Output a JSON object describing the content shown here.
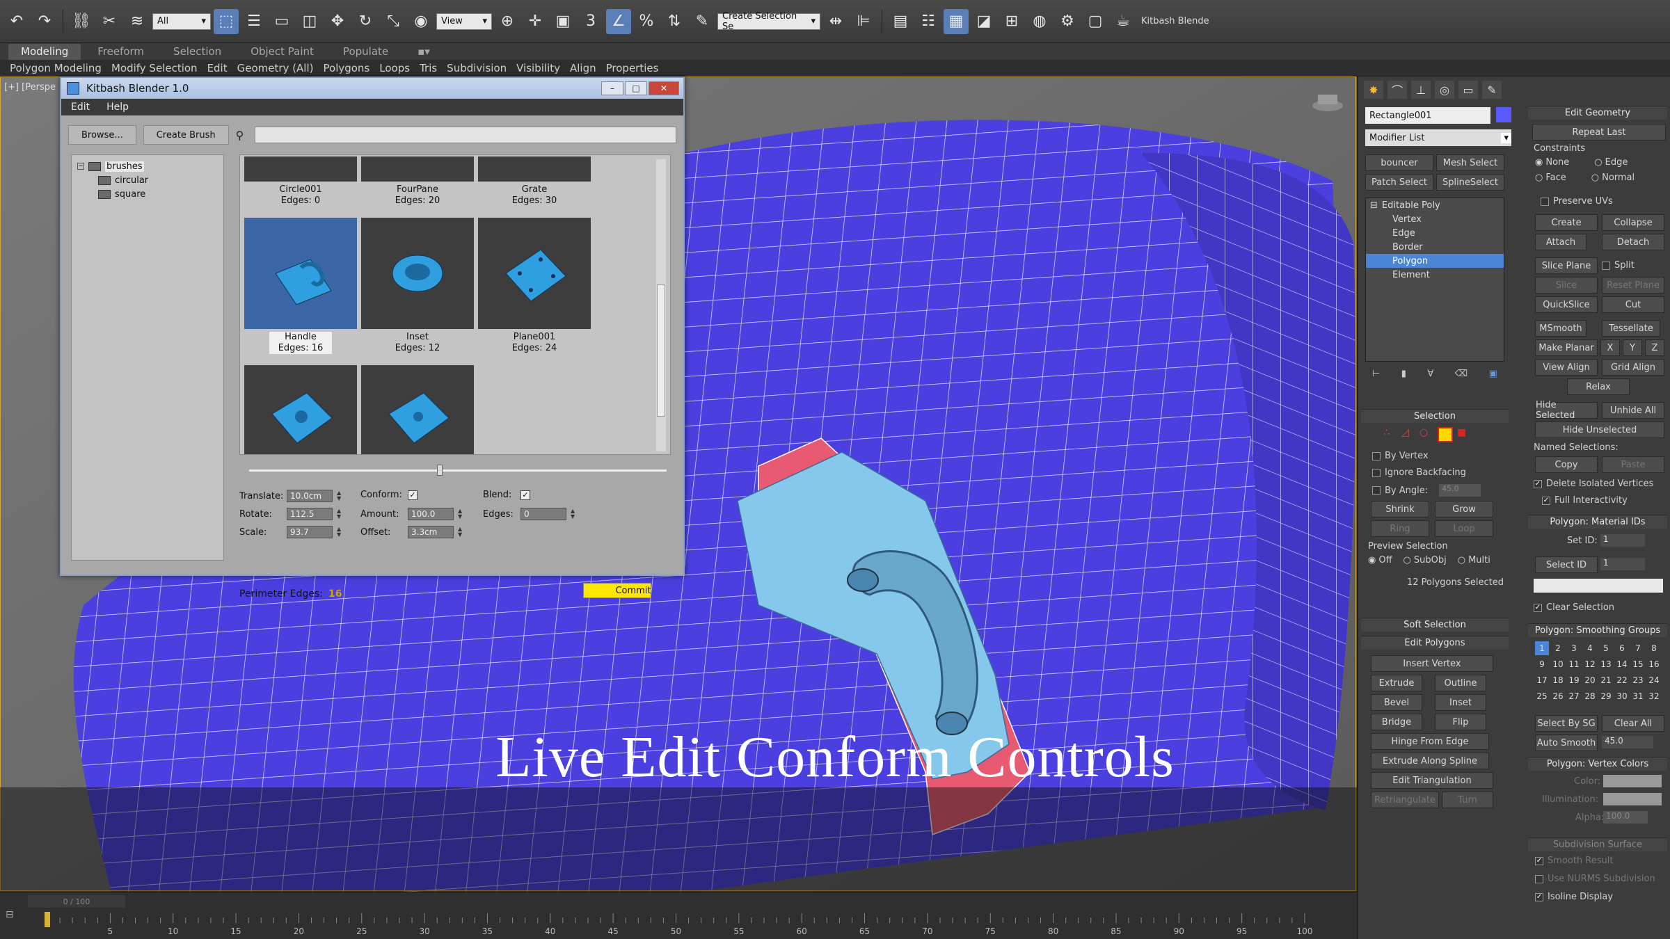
{
  "toolbar": {
    "selection_filter": "All",
    "ref_coord": "View",
    "named_selection": "Create Selection Se",
    "plugin_label": "Kitbash Blende",
    "snap_3": "3",
    "icons": [
      "undo-icon",
      "redo-icon",
      "link-icon",
      "unlink-icon",
      "bind-space-warp-icon",
      "select-object-icon",
      "select-by-name-icon",
      "rect-region-icon",
      "window-crossing-icon",
      "move-icon",
      "rotate-icon",
      "scale-icon",
      "place-icon",
      "pivot-icon",
      "snap-icon",
      "angle-snap-icon",
      "percent-snap-icon",
      "spinner-snap-icon",
      "edit-named-sel-icon",
      "mirror-icon",
      "align-icon",
      "layer-icon",
      "scene-explorer-icon",
      "graph-editor-icon",
      "material-editor-icon",
      "render-setup-icon",
      "render-frame-icon",
      "render-icon"
    ]
  },
  "ribbon": {
    "tabs": [
      "Modeling",
      "Freeform",
      "Selection",
      "Object Paint",
      "Populate"
    ],
    "active_tab": "Modeling",
    "subitems": [
      "Polygon Modeling",
      "Modify Selection",
      "Edit",
      "Geometry (All)",
      "Polygons",
      "Loops",
      "Tris",
      "Subdivision",
      "Visibility",
      "Align",
      "Properties"
    ]
  },
  "viewport": {
    "label": "[+] [Perspe",
    "caption": "Live Edit Conform Controls"
  },
  "kitbash": {
    "title": "Kitbash Blender 1.0",
    "menu": [
      "Edit",
      "Help"
    ],
    "browse": "Browse...",
    "create_brush": "Create Brush",
    "search_placeholder": "",
    "tree": {
      "root": "brushes",
      "children": [
        "circular",
        "square"
      ]
    },
    "brushes": [
      {
        "name": "Circle001",
        "edges": "Edges: 0"
      },
      {
        "name": "FourPane",
        "edges": "Edges: 20"
      },
      {
        "name": "Grate",
        "edges": "Edges: 30"
      },
      {
        "name": "Handle",
        "edges": "Edges: 16"
      },
      {
        "name": "Inset",
        "edges": "Edges: 12"
      },
      {
        "name": "Plane001",
        "edges": "Edges: 24"
      },
      {
        "name": "",
        "edges": ""
      },
      {
        "name": "",
        "edges": ""
      }
    ],
    "params": {
      "translate_label": "Translate:",
      "translate": "10.0cm",
      "rotate_label": "Rotate:",
      "rotate": "112.5",
      "scale_label": "Scale:",
      "scale": "93.7",
      "conform_label": "Conform:",
      "amount_label": "Amount:",
      "amount": "100.0",
      "offset_label": "Offset:",
      "offset": "3.3cm",
      "blend_label": "Blend:",
      "edges_label": "Edges:",
      "edges": "0"
    },
    "perimeter_label": "Perimeter Edges:",
    "perimeter_value": "16",
    "commit": "Commit",
    "colors": {
      "accent_yellow": "#ffe800"
    }
  },
  "command_panel": {
    "object_name": "Rectangle001",
    "modifier_list": "Modifier List",
    "buttons_top": [
      "bouncer",
      "Mesh Select",
      "Patch Select",
      "SplineSelect"
    ],
    "stack": [
      "Editable Poly",
      "Vertex",
      "Edge",
      "Border",
      "Polygon",
      "Element"
    ],
    "stack_selected": "Polygon",
    "selection": {
      "title": "Selection",
      "by_vertex": "By Vertex",
      "ignore_backfacing": "Ignore Backfacing",
      "by_angle": "By Angle:",
      "angle": "45.0",
      "shrink": "Shrink",
      "grow": "Grow",
      "ring": "Ring",
      "loop": "Loop",
      "preview_selection": "Preview Selection",
      "preview_opts": [
        "Off",
        "SubObj",
        "Multi"
      ],
      "status": "12 Polygons Selected"
    },
    "soft_selection": "Soft Selection",
    "edit_polygons": {
      "title": "Edit Polygons",
      "insert_vertex": "Insert Vertex",
      "extrude": "Extrude",
      "outline": "Outline",
      "bevel": "Bevel",
      "inset": "Inset",
      "bridge": "Bridge",
      "flip": "Flip",
      "hinge": "Hinge From Edge",
      "extrude_spline": "Extrude Along Spline",
      "edit_triangulation": "Edit Triangulation",
      "retriangulate": "Retriangulate",
      "turn": "Turn"
    },
    "edit_geometry": {
      "title": "Edit Geometry",
      "repeat_last": "Repeat Last",
      "constraints": "Constraints",
      "constraint_opts": [
        "None",
        "Edge",
        "Face",
        "Normal"
      ],
      "preserve_uvs": "Preserve UVs",
      "create": "Create",
      "collapse": "Collapse",
      "attach": "Attach",
      "detach": "Detach",
      "slice_plane": "Slice Plane",
      "split": "Split",
      "slice": "Slice",
      "reset_plane": "Reset Plane",
      "quickslice": "QuickSlice",
      "cut": "Cut",
      "msmooth": "MSmooth",
      "tessellate": "Tessellate",
      "make_planar": "Make Planar",
      "x": "X",
      "y": "Y",
      "z": "Z",
      "view_align": "View Align",
      "grid_align": "Grid Align",
      "relax": "Relax",
      "hide_selected": "Hide Selected",
      "unhide_all": "Unhide All",
      "hide_unselected": "Hide Unselected",
      "named_selections": "Named Selections:",
      "copy": "Copy",
      "paste": "Paste",
      "delete_isolated": "Delete Isolated Vertices",
      "full_interactivity": "Full Interactivity"
    },
    "material_ids": {
      "title": "Polygon: Material IDs",
      "set_id": "Set ID:",
      "set_id_val": "1",
      "select_id": "Select ID",
      "select_id_val": "1",
      "clear_selection": "Clear Selection"
    },
    "smoothing": {
      "title": "Polygon: Smoothing Groups",
      "numbers": [
        "1",
        "2",
        "3",
        "4",
        "5",
        "6",
        "7",
        "8",
        "9",
        "10",
        "11",
        "12",
        "13",
        "14",
        "15",
        "16",
        "17",
        "18",
        "19",
        "20",
        "21",
        "22",
        "23",
        "24",
        "25",
        "26",
        "27",
        "28",
        "29",
        "30",
        "31",
        "32"
      ],
      "select_by_sg": "Select By SG",
      "clear_all": "Clear All",
      "auto_smooth": "Auto Smooth",
      "auto_smooth_val": "45.0"
    },
    "vertex_colors": {
      "title": "Polygon: Vertex Colors",
      "color": "Color:",
      "illumination": "Illumination:",
      "alpha": "Alpha:",
      "alpha_val": "100.0"
    },
    "subdivision": {
      "title": "Subdivision Surface",
      "smooth_result": "Smooth Result",
      "use_nurms": "Use NURMS Subdivision",
      "isoline": "Isoline Display"
    }
  },
  "timeline": {
    "slider": "0 / 100",
    "ticks": [
      "5",
      "10",
      "15",
      "20",
      "25",
      "30",
      "35",
      "40",
      "45",
      "50",
      "55",
      "60",
      "65",
      "70",
      "75",
      "80",
      "85",
      "90",
      "95",
      "100"
    ]
  }
}
